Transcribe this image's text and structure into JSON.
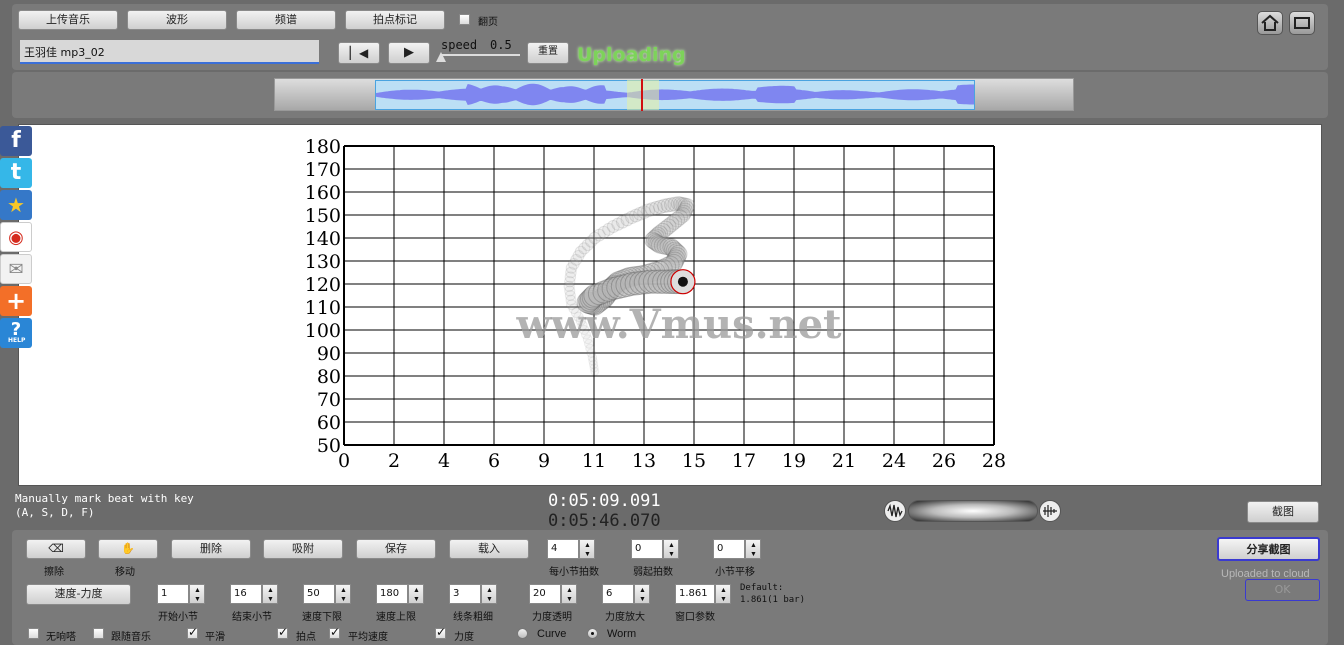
{
  "toolbar": {
    "upload_music": "上传音乐",
    "waveform": "波形",
    "spectrum": "频谱",
    "beat_mark": "拍点标记",
    "page_turn": "翻页",
    "file_name": "王羽佳 mp3_02",
    "speed_label": "speed",
    "speed_value": "0.5",
    "reset_button": "重置",
    "status": "Uploading"
  },
  "watermark": "www.Vmus.net",
  "playback": {
    "hint_line1": "Manually mark beat with key",
    "hint_line2": "(A, S, D, F)",
    "current_time": "0:05:09.091",
    "total_time": "0:05:46.070",
    "screenshot": "截图"
  },
  "controls": {
    "row1_buttons": [
      "擦除",
      "移动",
      "删除",
      "吸附",
      "保存",
      "载入"
    ],
    "beats_per_bar": {
      "value": "4",
      "label": "每小节拍数"
    },
    "pickup_beats": {
      "value": "0",
      "label": "弱起拍数"
    },
    "bar_shift": {
      "value": "0",
      "label": "小节平移"
    },
    "share_screenshot": "分享截图",
    "uploaded_note": "Uploaded to cloud",
    "ok_label": "OK",
    "tempo_dynamics": "速度-力度",
    "start_bar": {
      "value": "1",
      "label": "开始小节"
    },
    "end_bar": {
      "value": "16",
      "label": "结束小节"
    },
    "tempo_min": {
      "value": "50",
      "label": "速度下限"
    },
    "tempo_max": {
      "value": "180",
      "label": "速度上限"
    },
    "line_width": {
      "value": "3",
      "label": "线条粗细"
    },
    "dyn_opacity": {
      "value": "20",
      "label": "力度透明"
    },
    "dyn_scale": {
      "value": "6",
      "label": "力度放大"
    },
    "window_param": {
      "value": "1.861",
      "label": "窗口参数"
    },
    "default_line1": "Default:",
    "default_line2": "1.861(1 bar)",
    "checks": [
      {
        "label": "无响嗒",
        "checked": false
      },
      {
        "label": "跟随音乐",
        "checked": false
      },
      {
        "label": "平滑",
        "checked": true
      },
      {
        "label": "拍点",
        "checked": true
      },
      {
        "label": "平均速度",
        "checked": true
      },
      {
        "label": "力度",
        "checked": true
      }
    ],
    "mode_curve": "Curve",
    "mode_worm": "Worm",
    "mode_selected": "Worm"
  },
  "chart_data": {
    "type": "scatter",
    "title": "",
    "xlabel": "",
    "ylabel": "",
    "xlim": [
      0,
      28
    ],
    "ylim": [
      50,
      180
    ],
    "grid": true,
    "x_ticks": [
      "0",
      "2",
      "4",
      "6",
      "9",
      "11",
      "13",
      "15",
      "17",
      "19",
      "21",
      "24",
      "26",
      "28"
    ],
    "y_ticks": [
      "180",
      "170",
      "160",
      "150",
      "140",
      "130",
      "120",
      "110",
      "100",
      "90",
      "80",
      "70",
      "60",
      "50"
    ],
    "worm_path": [
      {
        "x": 10.8,
        "y": 82
      },
      {
        "x": 10.7,
        "y": 88
      },
      {
        "x": 10.5,
        "y": 96
      },
      {
        "x": 10.2,
        "y": 104
      },
      {
        "x": 9.8,
        "y": 111
      },
      {
        "x": 9.7,
        "y": 119
      },
      {
        "x": 9.8,
        "y": 127
      },
      {
        "x": 10.2,
        "y": 134
      },
      {
        "x": 10.8,
        "y": 140
      },
      {
        "x": 11.6,
        "y": 145
      },
      {
        "x": 12.4,
        "y": 149
      },
      {
        "x": 13.1,
        "y": 152
      },
      {
        "x": 13.8,
        "y": 154
      },
      {
        "x": 14.4,
        "y": 155
      },
      {
        "x": 14.8,
        "y": 154
      },
      {
        "x": 14.6,
        "y": 150
      },
      {
        "x": 14.1,
        "y": 146
      },
      {
        "x": 13.6,
        "y": 142
      },
      {
        "x": 13.3,
        "y": 139
      },
      {
        "x": 13.6,
        "y": 137
      },
      {
        "x": 14.1,
        "y": 136
      },
      {
        "x": 14.4,
        "y": 133
      },
      {
        "x": 14.2,
        "y": 129
      },
      {
        "x": 13.6,
        "y": 126
      },
      {
        "x": 12.9,
        "y": 124
      },
      {
        "x": 12.3,
        "y": 123
      },
      {
        "x": 11.8,
        "y": 121
      },
      {
        "x": 11.5,
        "y": 118
      },
      {
        "x": 11.2,
        "y": 114
      },
      {
        "x": 10.8,
        "y": 111
      },
      {
        "x": 10.5,
        "y": 112
      },
      {
        "x": 10.8,
        "y": 115
      },
      {
        "x": 11.6,
        "y": 118
      },
      {
        "x": 12.4,
        "y": 120
      },
      {
        "x": 13.2,
        "y": 121
      },
      {
        "x": 14.0,
        "y": 121
      },
      {
        "x": 14.6,
        "y": 121
      }
    ]
  }
}
